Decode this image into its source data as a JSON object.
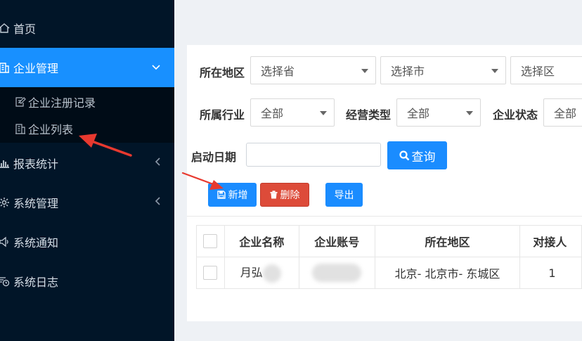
{
  "sidebar": {
    "items": [
      {
        "label": "首页",
        "icon": "home-icon"
      },
      {
        "label": "企业管理",
        "icon": "building-icon",
        "active": true
      },
      {
        "label": "报表统计",
        "icon": "bar-chart-icon"
      },
      {
        "label": "系统管理",
        "icon": "gear-icon"
      },
      {
        "label": "系统通知",
        "icon": "speaker-icon"
      },
      {
        "label": "系统日志",
        "icon": "clock-log-icon"
      }
    ],
    "submenu": [
      {
        "label": "企业注册记录",
        "icon": "edit-doc-icon"
      },
      {
        "label": "企业列表",
        "icon": "building-list-icon"
      }
    ]
  },
  "filters": {
    "region_label": "所在地区",
    "province_placeholder": "选择省",
    "city_placeholder": "选择市",
    "district_placeholder": "选择区",
    "industry_label": "所属行业",
    "industry_value": "全部",
    "business_type_label": "经营类型",
    "business_type_value": "全部",
    "status_label": "企业状态",
    "status_value": "全部",
    "start_date_label": "启动日期",
    "start_date_value": "",
    "query_button": "查询"
  },
  "toolbar": {
    "add_label": "新增",
    "delete_label": "删除",
    "export_label": "导出"
  },
  "table": {
    "headers": [
      "企业名称",
      "企业账号",
      "所在地区",
      "对接人"
    ],
    "rows": [
      {
        "name": "月弘",
        "account": "",
        "region": "北京- 北京市- 东城区",
        "contact": "1"
      }
    ]
  },
  "colors": {
    "sidebar_bg": "#011528",
    "active": "#1890ff",
    "primary_button": "#1a8cff",
    "danger_button": "#dd4b39",
    "annotation_arrow": "#e8392f"
  }
}
